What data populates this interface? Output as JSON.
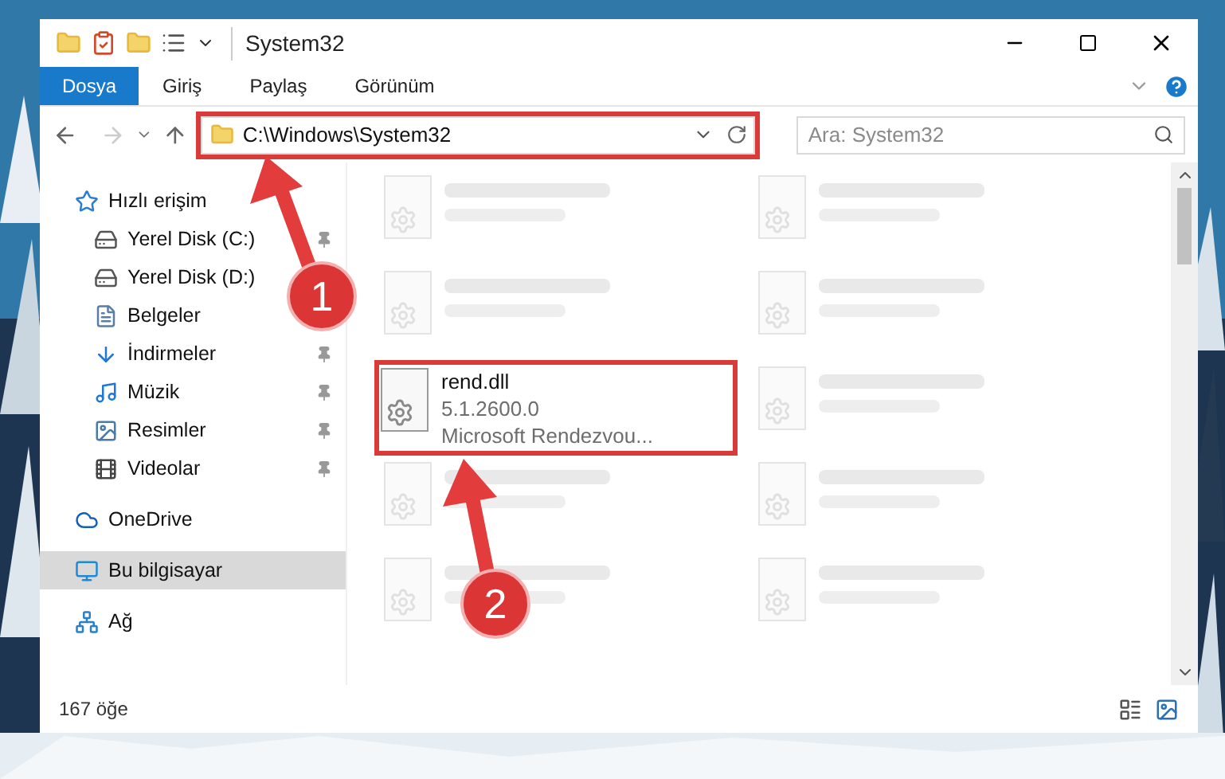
{
  "window": {
    "title": "System32"
  },
  "ribbon_tabs": [
    {
      "label": "Dosya",
      "kind": "file"
    },
    {
      "label": "Giriş",
      "kind": "tab"
    },
    {
      "label": "Paylaş",
      "kind": "tab"
    },
    {
      "label": "Görünüm",
      "kind": "tab"
    }
  ],
  "address": {
    "path": "C:\\Windows\\System32",
    "highlighted": true
  },
  "search": {
    "placeholder": "Ara: System32"
  },
  "nav": [
    {
      "label": "Hızlı erişim",
      "kind": "star",
      "selected": false,
      "children": [
        {
          "label": "Yerel Disk (C:)",
          "kind": "disk",
          "selected": false,
          "pinned": true
        },
        {
          "label": "Yerel Disk (D:)",
          "kind": "disk",
          "selected": false
        },
        {
          "label": "Belgeler",
          "kind": "docs",
          "selected": false
        },
        {
          "label": "İndirmeler",
          "kind": "download",
          "selected": false,
          "pinned": true
        },
        {
          "label": "Müzik",
          "kind": "music",
          "selected": false,
          "pinned": true
        },
        {
          "label": "Resimler",
          "kind": "pictures",
          "selected": false,
          "pinned": true
        },
        {
          "label": "Videolar",
          "kind": "video",
          "selected": false,
          "pinned": true
        }
      ]
    },
    {
      "label": "OneDrive",
      "kind": "cloud",
      "selected": false
    },
    {
      "label": "Bu bilgisayar",
      "kind": "pc",
      "selected": true
    },
    {
      "label": "Ağ",
      "kind": "network",
      "selected": false
    }
  ],
  "files": [
    {
      "kind": "blurred"
    },
    {
      "kind": "blurred"
    },
    {
      "kind": "blurred"
    },
    {
      "kind": "blurred"
    },
    {
      "kind": "file",
      "name": "rend.dll",
      "lines": [
        "5.1.2600.0",
        "Microsoft Rendezvou..."
      ],
      "highlighted": true
    },
    {
      "kind": "blurred"
    },
    {
      "kind": "blurred"
    },
    {
      "kind": "blurred"
    },
    {
      "kind": "blurred"
    },
    {
      "kind": "blurred"
    }
  ],
  "status_bar": {
    "count": "167 öğe"
  },
  "annotations": [
    {
      "label": "1"
    },
    {
      "label": "2"
    }
  ]
}
